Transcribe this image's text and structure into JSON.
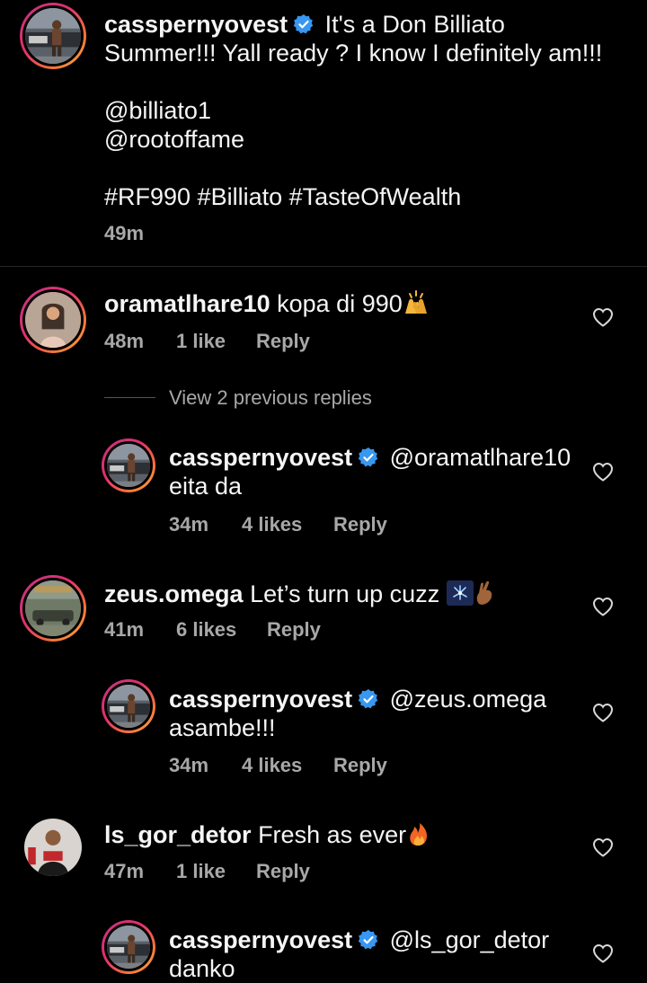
{
  "post": {
    "username": "casspernyovest",
    "caption_line1": "It's a Don Billiato",
    "caption_line2": "Summer!!! Yall ready ? I know I definitely am!!!",
    "mention1": "@billiato1",
    "mention2": "@rootoffame",
    "hashtags": "#RF990 #Billiato #TasteOfWealth",
    "time": "49m"
  },
  "comments": [
    {
      "username": "oramatlhare10",
      "text": "kopa di 990",
      "emoji": "raised-hands-emoji",
      "time": "48m",
      "likes": "1 like",
      "reply_label": "Reply",
      "view_replies": "View 2 previous replies",
      "reply": {
        "username": "casspernyovest",
        "mention": "@oramatlhare10",
        "text": "eita da",
        "time": "34m",
        "likes": "4 likes",
        "reply_label": "Reply"
      }
    },
    {
      "username": "zeus.omega",
      "text": "Let’s turn up cuzz",
      "emoji": "fireworks-crossed-fingers-emoji",
      "time": "41m",
      "likes": "6 likes",
      "reply_label": "Reply",
      "reply": {
        "username": "casspernyovest",
        "mention": "@zeus.omega",
        "text": "asambe!!!",
        "time": "34m",
        "likes": "4 likes",
        "reply_label": "Reply"
      }
    },
    {
      "username": "ls_gor_detor",
      "text": "Fresh as ever",
      "emoji": "fire-emoji",
      "time": "47m",
      "likes": "1 like",
      "reply_label": "Reply",
      "reply": {
        "username": "casspernyovest",
        "mention": "@ls_gor_detor",
        "text": "danko"
      }
    }
  ],
  "colors": {
    "background": "#000000",
    "text": "#f5f5f5",
    "secondary_text": "#a8a8a8",
    "verified_badge": "#3897f0"
  }
}
